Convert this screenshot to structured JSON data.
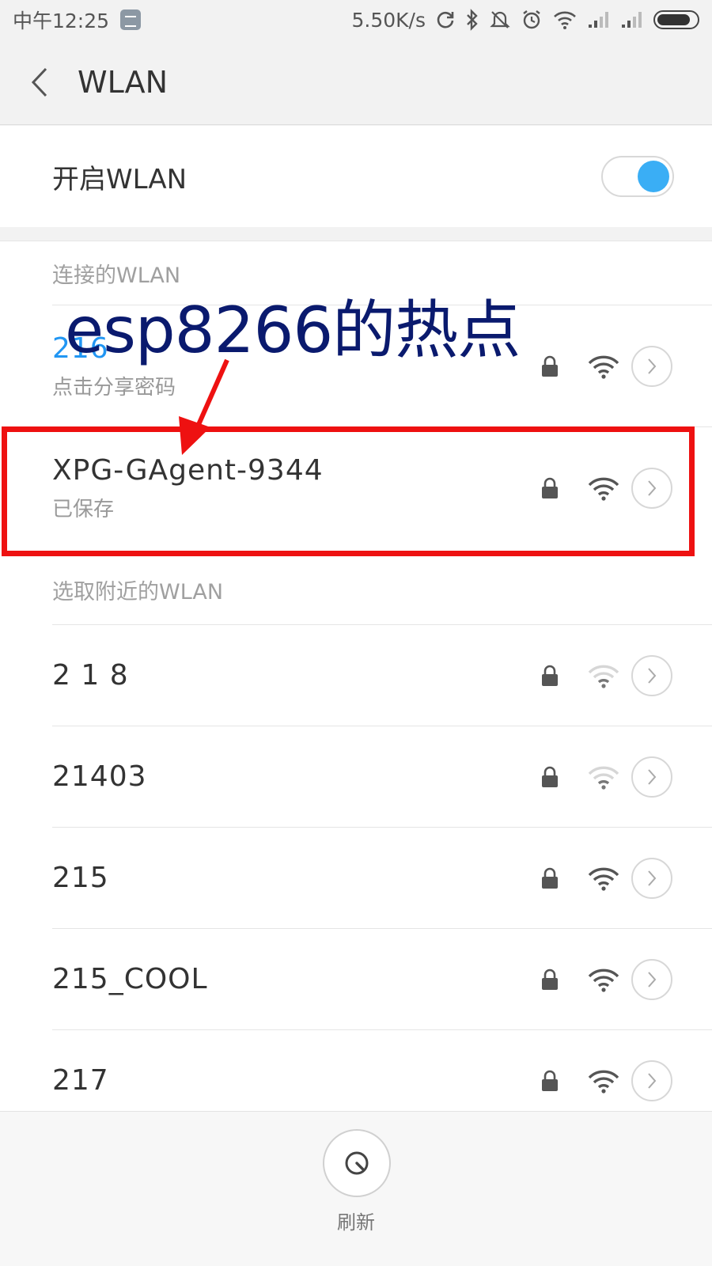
{
  "status_bar": {
    "time": "中午12:25",
    "network_speed": "5.50K/s",
    "icons": [
      "app-notification-icon",
      "sync-icon",
      "bluetooth-icon",
      "mute-icon",
      "alarm-icon",
      "wifi-icon",
      "signal-icon",
      "signal-icon",
      "battery-icon"
    ],
    "battery_level": 0.85
  },
  "header": {
    "back_icon": "chevron-left-icon",
    "title": "WLAN"
  },
  "toggle": {
    "label": "开启WLAN",
    "enabled": true,
    "accent_color": "#3aaef5"
  },
  "connected": {
    "header": "连接的WLAN",
    "networks": [
      {
        "ssid": "216",
        "subtitle": "点击分享密码",
        "locked": true,
        "signal": "strong"
      },
      {
        "ssid": "XPG-GAgent-9344",
        "subtitle": "已保存",
        "locked": true,
        "signal": "strong"
      }
    ]
  },
  "nearby": {
    "header": "选取附近的WLAN",
    "networks": [
      {
        "ssid": "2 1 8",
        "locked": true,
        "signal": "weak"
      },
      {
        "ssid": "21403",
        "locked": true,
        "signal": "weak"
      },
      {
        "ssid": "215",
        "locked": true,
        "signal": "strong"
      },
      {
        "ssid": "215_COOL",
        "locked": true,
        "signal": "strong"
      },
      {
        "ssid": "217",
        "locked": true,
        "signal": "strong"
      }
    ]
  },
  "annotation": {
    "text": "esp8266的热点",
    "color": "#0a1a6e",
    "highlight_color": "#ee1111"
  },
  "footer": {
    "refresh_label": "刷新",
    "refresh_icon": "refresh-icon"
  }
}
